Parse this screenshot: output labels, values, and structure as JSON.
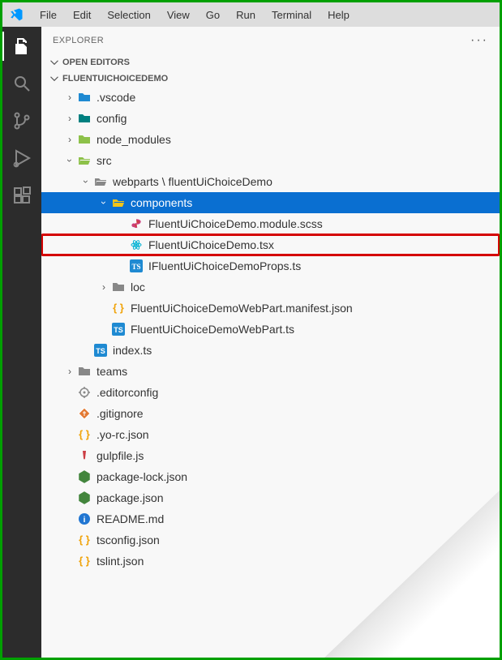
{
  "menubar": {
    "items": [
      "File",
      "Edit",
      "Selection",
      "View",
      "Go",
      "Run",
      "Terminal",
      "Help"
    ]
  },
  "explorer": {
    "title": "EXPLORER",
    "openEditors": "OPEN EDITORS",
    "project": "FLUENTUICHOICEDEMO"
  },
  "activitybar": {
    "items": [
      "explorer",
      "search",
      "source-control",
      "debug",
      "extensions"
    ]
  },
  "tree": {
    "vscode": ".vscode",
    "config": "config",
    "node_modules": "node_modules",
    "src": "src",
    "webparts": "webparts \\ fluentUiChoiceDemo",
    "components": "components",
    "scss": "FluentUiChoiceDemo.module.scss",
    "tsx": "FluentUiChoiceDemo.tsx",
    "props": "IFluentUiChoiceDemoProps.ts",
    "loc": "loc",
    "manifest": "FluentUiChoiceDemoWebPart.manifest.json",
    "webpart_ts": "FluentUiChoiceDemoWebPart.ts",
    "index_ts": "index.ts",
    "teams": "teams",
    "editorconfig": ".editorconfig",
    "gitignore": ".gitignore",
    "yorc": ".yo-rc.json",
    "gulpfile": "gulpfile.js",
    "pkglock": "package-lock.json",
    "pkg": "package.json",
    "readme": "README.md",
    "tsconfig": "tsconfig.json",
    "tslint": "tslint.json"
  }
}
